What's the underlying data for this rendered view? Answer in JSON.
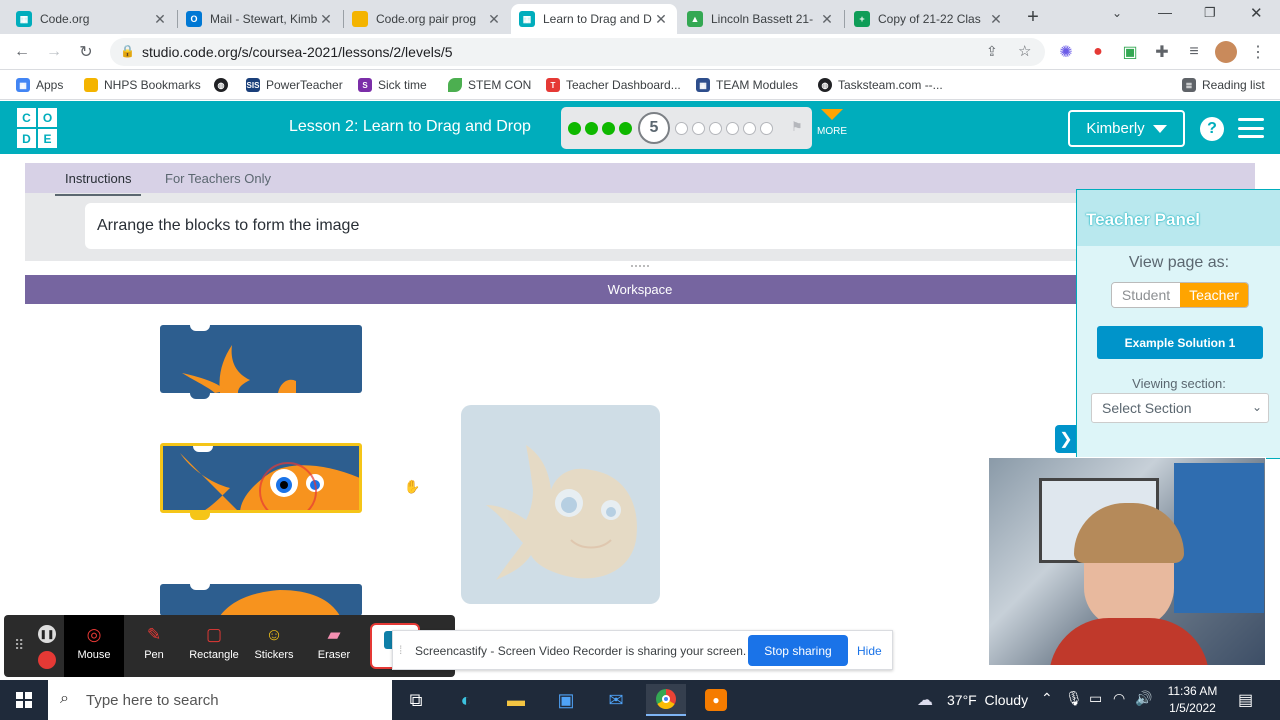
{
  "browser": {
    "tabs": [
      {
        "title": "Code.org",
        "fav_color": "#00adbc",
        "active": false
      },
      {
        "title": "Mail - Stewart, Kimb",
        "fav_color": "#0078d4",
        "active": false
      },
      {
        "title": "Code.org pair prog",
        "fav_color": "#f4b400",
        "active": false
      },
      {
        "title": "Learn to Drag and D",
        "fav_color": "#00adbc",
        "active": true
      },
      {
        "title": "Lincoln Bassett 21-",
        "fav_color": "#34a853",
        "active": false
      },
      {
        "title": "Copy of 21-22 Clas",
        "fav_color": "#0f9d58",
        "active": false
      }
    ],
    "new_tab": "+",
    "url": "studio.code.org/s/coursea-2021/lessons/2/levels/5",
    "bookmarks": [
      {
        "label": "Apps",
        "color": "#4285f4"
      },
      {
        "label": "NHPS Bookmarks",
        "color": "#f4b400"
      },
      {
        "label": "",
        "color": "#202124"
      },
      {
        "label": "PowerTeacher",
        "color": "#1a3f7a"
      },
      {
        "label": "Sick time",
        "color": "#7b2ea8"
      },
      {
        "label": "STEM CON",
        "color": "#4caf50"
      },
      {
        "label": "Teacher Dashboard...",
        "color": "#e53935"
      },
      {
        "label": "TEAM Modules",
        "color": "#2e4e8c"
      },
      {
        "label": "Tasksteam.com --...",
        "color": "#202124"
      }
    ],
    "reading_list": "Reading list"
  },
  "header": {
    "logo_letters": [
      "C",
      "O",
      "D",
      "E"
    ],
    "lesson_title": "Lesson 2: Learn to Drag and Drop",
    "current_level": "5",
    "completed_levels": 4,
    "remaining_levels": 6,
    "more_label": "MORE",
    "user_name": "Kimberly",
    "help_label": "?"
  },
  "instructions": {
    "tab_instructions": "Instructions",
    "tab_teachers": "For Teachers Only",
    "text": "Arrange the blocks to form the image"
  },
  "workspace": {
    "title": "Workspace"
  },
  "teacher_panel": {
    "title": "Teacher Panel",
    "view_label": "View page as:",
    "student_label": "Student",
    "teacher_label": "Teacher",
    "solution_button": "Example Solution 1",
    "section_label": "Viewing section:",
    "section_select": "Select Section"
  },
  "screencastify": {
    "tools": [
      "Mouse",
      "Pen",
      "Rectangle",
      "Stickers",
      "Eraser"
    ],
    "share_text": "Screencastify - Screen Video Recorder is sharing your screen.",
    "stop_label": "Stop sharing",
    "hide_label": "Hide"
  },
  "taskbar": {
    "search_placeholder": "Type here to search",
    "weather": "37°F  Cloudy",
    "time": "11:36 AM",
    "date": "1/5/2022"
  },
  "colors": {
    "codeorg_teal": "#00adbc",
    "workspace_purple": "#7665a0",
    "teacher_orange": "#ffa400",
    "solution_blue": "#0094ca",
    "progress_green": "#0fb800"
  }
}
